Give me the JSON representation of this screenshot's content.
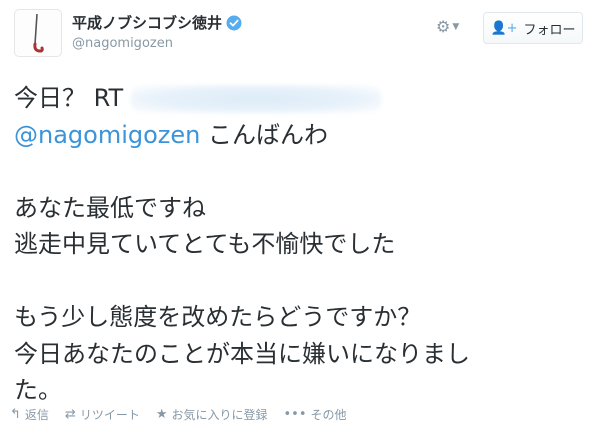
{
  "user": {
    "display_name": "平成ノブシコブシ徳井",
    "handle": "@nagomigozen",
    "verified": true
  },
  "header": {
    "follow_label": "フォロー"
  },
  "tweet": {
    "line1_prefix": "今日？ RT",
    "mention": "@nagomigozen",
    "line2_suffix": " こんばんわ",
    "line3": "あなた最低ですね",
    "line4": "逃走中見ていてとても不愉快でした",
    "line5": "もう少し態度を改めたらどうですか？",
    "line6": "今日あなたのことが本当に嫌いになりまし",
    "line7": "た。"
  },
  "actions": {
    "reply": "返信",
    "retweet": "リツイート",
    "favorite": "お気に入りに登録",
    "more": "その他"
  },
  "colors": {
    "link": "#3b94d9",
    "muted": "#8899a6",
    "text": "#292f33",
    "verified": "#55acee"
  }
}
